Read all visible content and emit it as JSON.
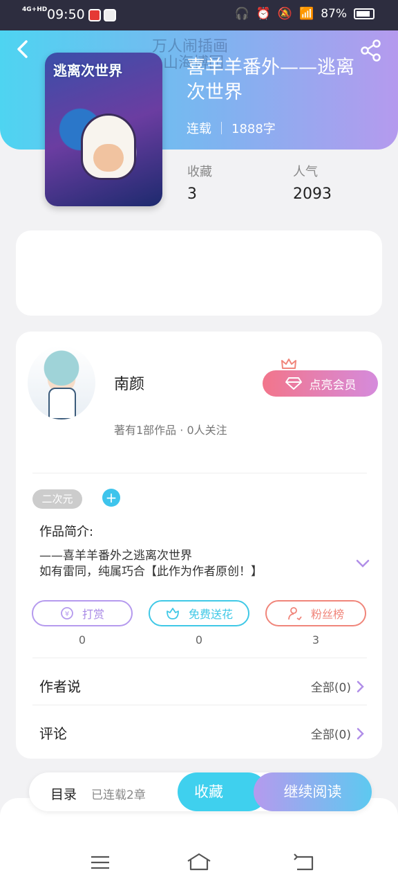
{
  "status_bar": {
    "network": "4G+HD",
    "time": "09:50",
    "battery": "87%"
  },
  "book": {
    "watermark_line1": "万人闹插画",
    "watermark_line2": "山海博园",
    "cover_title": "逃离次世界",
    "title": "喜羊羊番外——逃离次世界",
    "status": "连载",
    "word_count": "1888字",
    "stats": [
      {
        "label": "收藏",
        "value": "3"
      },
      {
        "label": "人气",
        "value": "2093"
      }
    ]
  },
  "author": {
    "name": "南颜",
    "stats_text": "著有1部作品 · 0人关注",
    "vip_button": "点亮会员"
  },
  "tags": [
    "二次元"
  ],
  "tag_add": "+",
  "intro": {
    "label": "作品简介:",
    "line1": "——喜羊羊番外之逃离次世界",
    "line2": "如有雷同，纯属巧合【此作为作者原创！】"
  },
  "actions": [
    {
      "label": "打赏",
      "count": "0",
      "color": "#b59aee"
    },
    {
      "label": "免费送花",
      "count": "0",
      "color": "#3fc8e6"
    },
    {
      "label": "粉丝榜",
      "count": "3",
      "color": "#f0857a"
    }
  ],
  "author_says": {
    "label": "作者说",
    "all": "全部(0)"
  },
  "comments": {
    "label": "评论",
    "all": "全部(0)"
  },
  "bottom_bar": {
    "toc": "目录",
    "serial": "已连载2章",
    "favorite": "收藏",
    "continue": "继续阅读"
  },
  "icons": {
    "back": "back-arrow-icon",
    "share": "share-icon",
    "crown": "crown-icon",
    "diamond": "diamond-icon",
    "chevron": "chevron-down-icon",
    "right": "chevron-right-icon",
    "menu": "menu-icon",
    "home": "home-icon",
    "return": "return-icon"
  }
}
